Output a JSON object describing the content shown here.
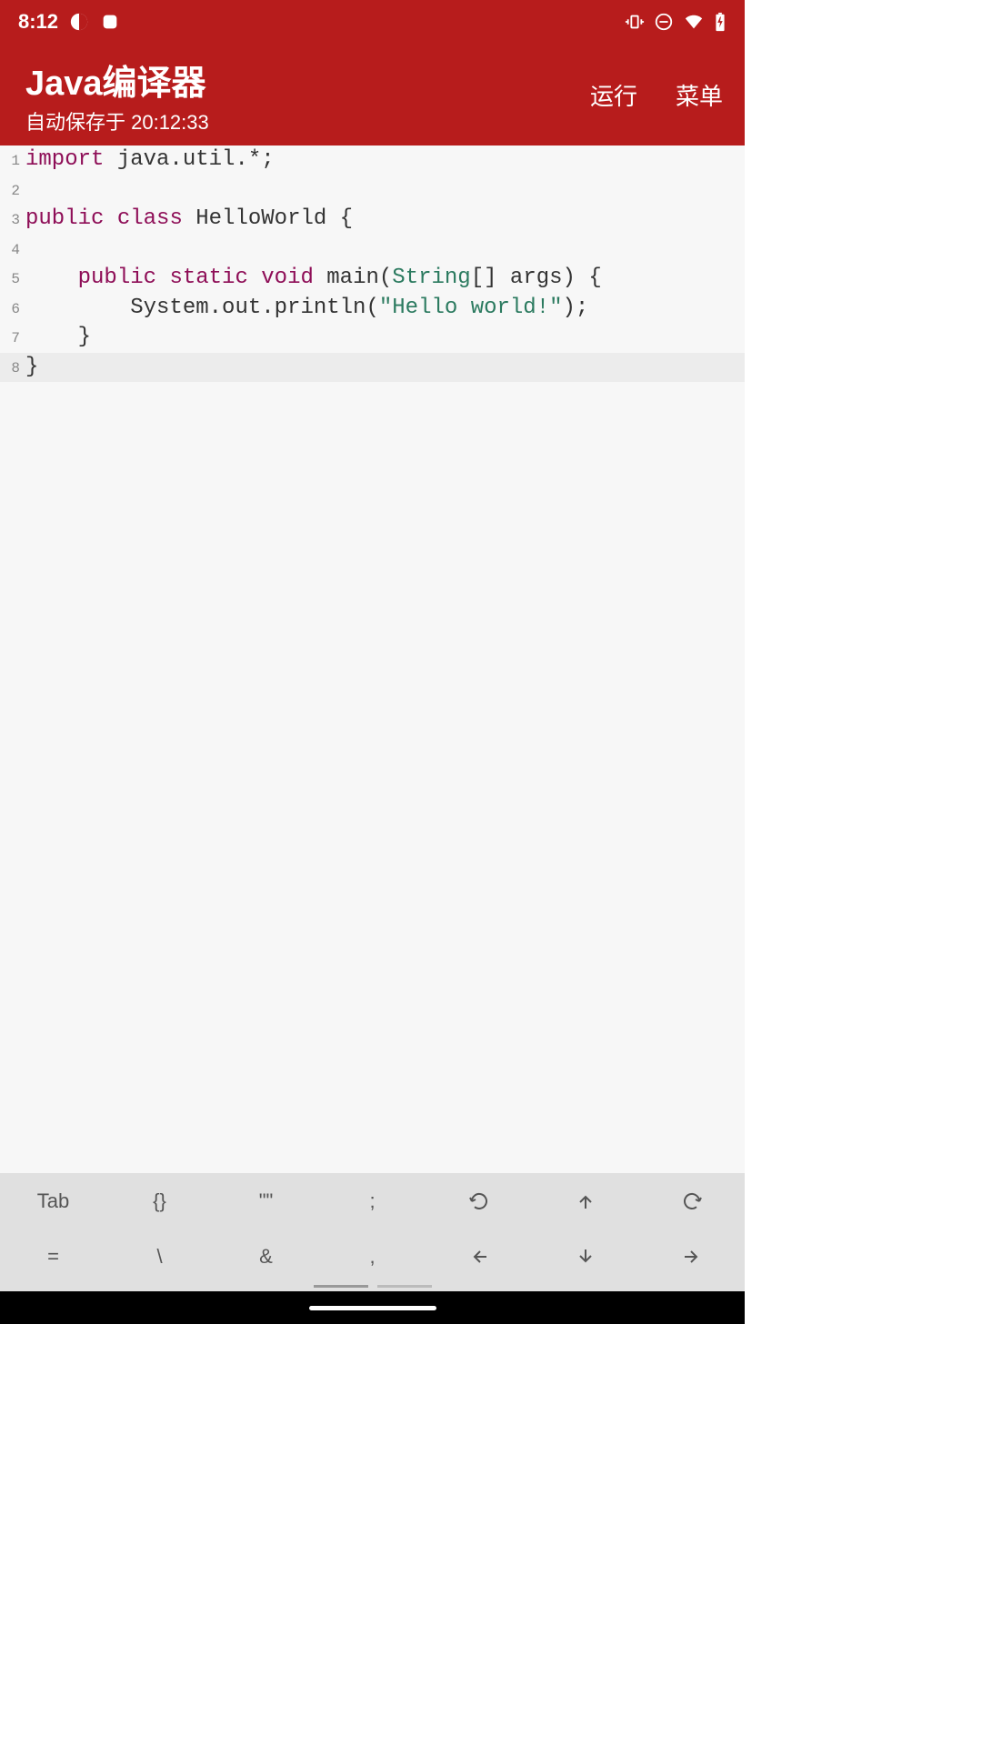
{
  "status": {
    "time": "8:12"
  },
  "header": {
    "title": "Java编译器",
    "subtitle": "自动保存于 20:12:33",
    "actions": {
      "run": "运行",
      "menu": "菜单"
    }
  },
  "code": {
    "lines": [
      {
        "num": "1",
        "tokens": [
          {
            "t": "import",
            "c": "kw"
          },
          {
            "t": " java.util.*;",
            "c": "punct"
          }
        ]
      },
      {
        "num": "2",
        "tokens": []
      },
      {
        "num": "3",
        "tokens": [
          {
            "t": "public",
            "c": "kw"
          },
          {
            "t": " ",
            "c": ""
          },
          {
            "t": "class",
            "c": "kw"
          },
          {
            "t": " HelloWorld {",
            "c": "punct"
          }
        ]
      },
      {
        "num": "4",
        "tokens": []
      },
      {
        "num": "5",
        "tokens": [
          {
            "t": "    ",
            "c": ""
          },
          {
            "t": "public",
            "c": "kw"
          },
          {
            "t": " ",
            "c": ""
          },
          {
            "t": "static",
            "c": "kw"
          },
          {
            "t": " ",
            "c": ""
          },
          {
            "t": "void",
            "c": "kw"
          },
          {
            "t": " main(",
            "c": "punct"
          },
          {
            "t": "String",
            "c": "type"
          },
          {
            "t": "[] args) {",
            "c": "punct"
          }
        ]
      },
      {
        "num": "6",
        "tokens": [
          {
            "t": "        System.out.println(",
            "c": "punct"
          },
          {
            "t": "\"Hello world!\"",
            "c": "str"
          },
          {
            "t": ");",
            "c": "punct"
          }
        ]
      },
      {
        "num": "7",
        "tokens": [
          {
            "t": "    }",
            "c": "punct"
          }
        ]
      },
      {
        "num": "8",
        "tokens": [
          {
            "t": "}",
            "c": "punct"
          }
        ],
        "current": true
      }
    ]
  },
  "keyboard": {
    "row1": [
      "Tab",
      "{}",
      "\"\"",
      ";",
      "undo",
      "up",
      "redo"
    ],
    "row2": [
      "=",
      "\\",
      "&",
      ",",
      "left",
      "down",
      "right"
    ]
  }
}
